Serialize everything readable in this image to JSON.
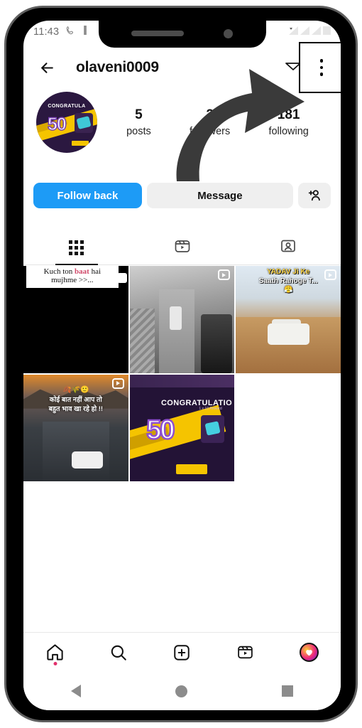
{
  "app": "Instagram profile",
  "status_bar": {
    "time": "11:43",
    "call_icon": "phone-icon",
    "signal_icon": "signal-icon",
    "wifi_icon": "wifi-icon",
    "battery_icon": "battery-icon"
  },
  "header": {
    "back_icon": "back-arrow-icon",
    "username": "olaveni0009",
    "share_icon": "share-envelope-icon",
    "menu_icon": "kebab-menu-icon"
  },
  "annotation": {
    "arrow_color": "#3a3a3a",
    "highlight_target": "kebab-menu-icon",
    "highlight_border_color": "#000000"
  },
  "profile": {
    "avatar_name": "profile-avatar",
    "avatar_text": "CONGRATULA",
    "avatar_number": "50",
    "stats": [
      {
        "num": "5",
        "label": "posts"
      },
      {
        "num": "2",
        "label": "followers"
      },
      {
        "num": "181",
        "label": "following"
      }
    ]
  },
  "actions": {
    "follow_label": "Follow back",
    "follow_color": "#1d9bf6",
    "message_label": "Message",
    "message_color": "#efefef",
    "adduser_icon": "add-person-icon"
  },
  "tabs": [
    {
      "name": "grid",
      "icon": "grid-icon",
      "active": true
    },
    {
      "name": "reels",
      "icon": "reels-icon",
      "active": false
    },
    {
      "name": "tagged",
      "icon": "tagged-person-icon",
      "active": false
    }
  ],
  "posts": [
    {
      "id": "post-1",
      "caption_line1_a": "Kuch ton ",
      "caption_line1_b": "baat",
      "caption_line1_c": " hai",
      "caption_line2": "mujhme >>...",
      "is_reel": false,
      "type": "text-banner-black"
    },
    {
      "id": "post-2",
      "caption": "",
      "is_reel": true,
      "type": "black-and-white-street"
    },
    {
      "id": "post-3",
      "caption_line1": "YADAV Ji Ke",
      "caption_line2": "Saath Rahoge T...",
      "emoji": "😤",
      "is_reel": true,
      "type": "desert-suv"
    },
    {
      "id": "post-4",
      "emoji_row": "🍂🌾🙂",
      "caption_line1": "कोई बात नहीं आप तो",
      "caption_line2": "बहुत भाव खा रहे हो !!",
      "is_reel": true,
      "type": "night-highway-car"
    },
    {
      "id": "post-5",
      "caption": "CONGRATULATIO",
      "number": "50",
      "reward_text": "1 x 10 Reward",
      "is_reel": false,
      "type": "congratulations-banner"
    }
  ],
  "bottom_nav": [
    {
      "name": "home",
      "icon": "home-icon",
      "badge": true
    },
    {
      "name": "search",
      "icon": "search-icon",
      "badge": false
    },
    {
      "name": "create",
      "icon": "plus-square-icon",
      "badge": false
    },
    {
      "name": "reels",
      "icon": "reels-icon",
      "badge": false
    },
    {
      "name": "profile",
      "icon": "profile-avatar-icon",
      "badge": false
    }
  ],
  "android_nav": [
    {
      "name": "back",
      "icon": "android-back-icon"
    },
    {
      "name": "home",
      "icon": "android-home-icon"
    },
    {
      "name": "recents",
      "icon": "android-recents-icon"
    }
  ]
}
